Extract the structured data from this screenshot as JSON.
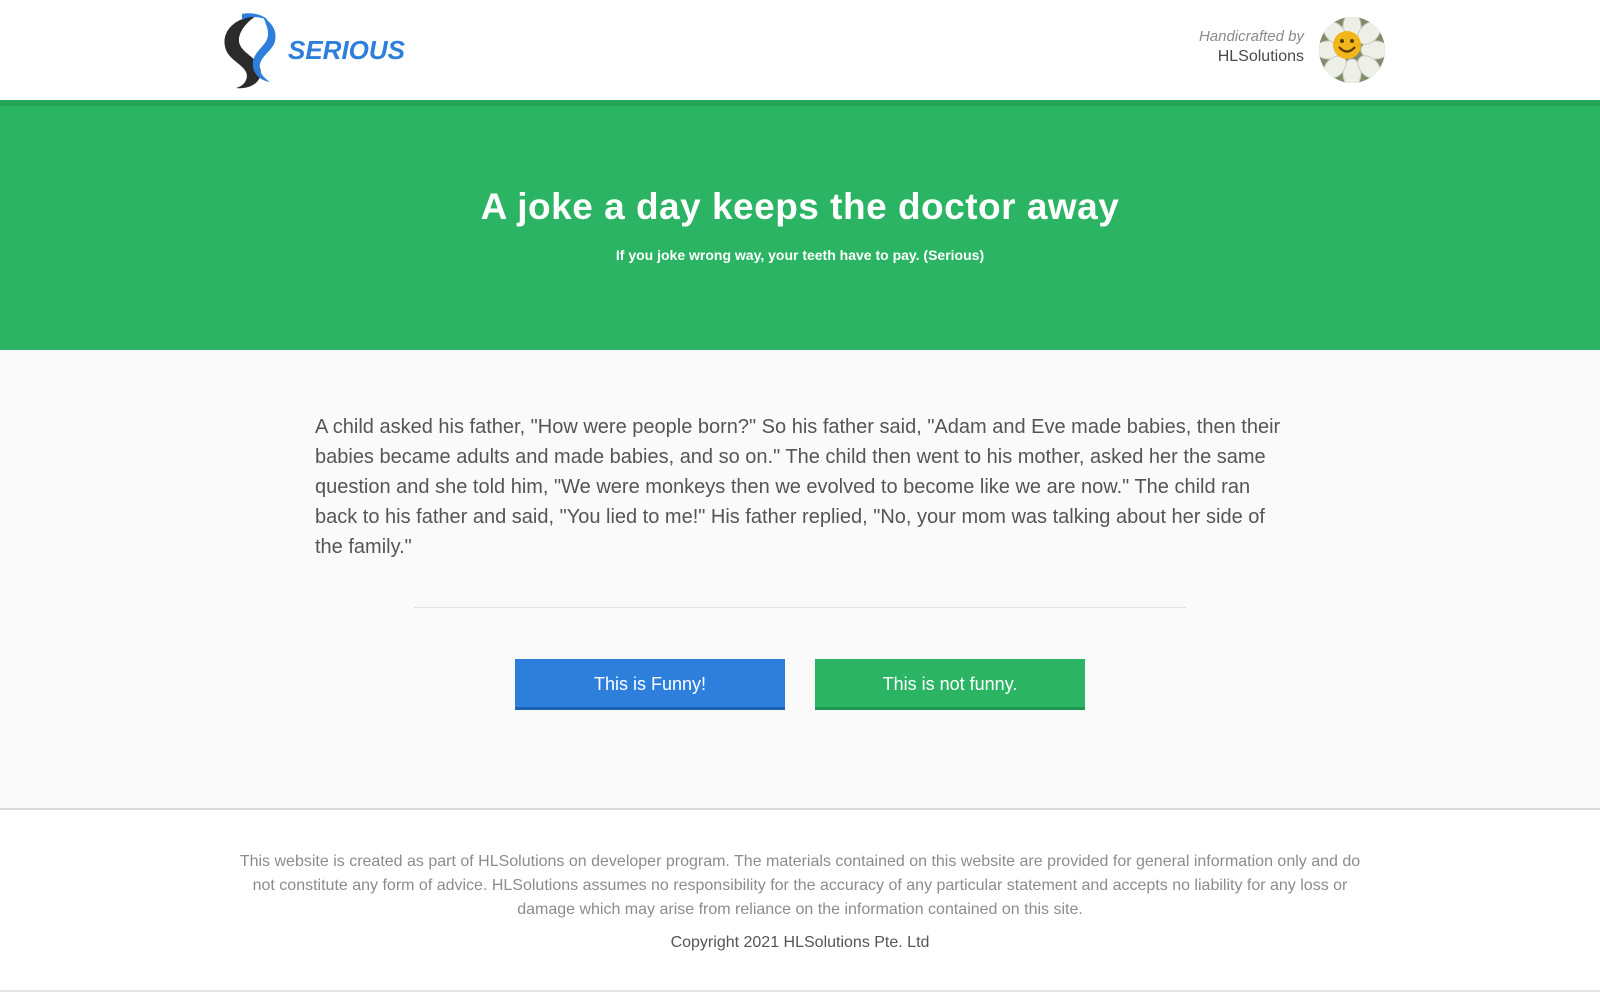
{
  "header": {
    "logo_text": "SERIOUS",
    "credit_by": "Handicrafted by",
    "credit_name": "HLSolutions",
    "avatar_icon": "smiling-flower-icon"
  },
  "hero": {
    "title": "A joke a day keeps the doctor away",
    "subtitle": "If you joke wrong way, your teeth have to pay. (Serious)"
  },
  "joke": {
    "text": "A child asked his father, \"How were people born?\" So his father said, \"Adam and Eve made babies, then their babies became adults and made babies, and so on.\" The child then went to his mother, asked her the same question and she told him, \"We were monkeys then we evolved to become like we are now.\" The child ran back to his father and said, \"You lied to me!\" His father replied, \"No, your mom was talking about her side of the family.\""
  },
  "buttons": {
    "funny_label": "This is Funny!",
    "not_funny_label": "This is not funny."
  },
  "footer": {
    "disclaimer": "This website is created as part of HLSolutions on developer program. The materials contained on this website are provided for general information only and do not constitute any form of advice. HLSolutions assumes no responsibility for the accuracy of any particular statement and accepts no liability for any loss or damage which may arise from reliance on the information contained on this site.",
    "copyright": "Copyright 2021 HLSolutions Pte. Ltd"
  },
  "colors": {
    "brand_green": "#2bb463",
    "brand_blue": "#2d7fdb",
    "logo_dark": "#2b2b2b"
  }
}
